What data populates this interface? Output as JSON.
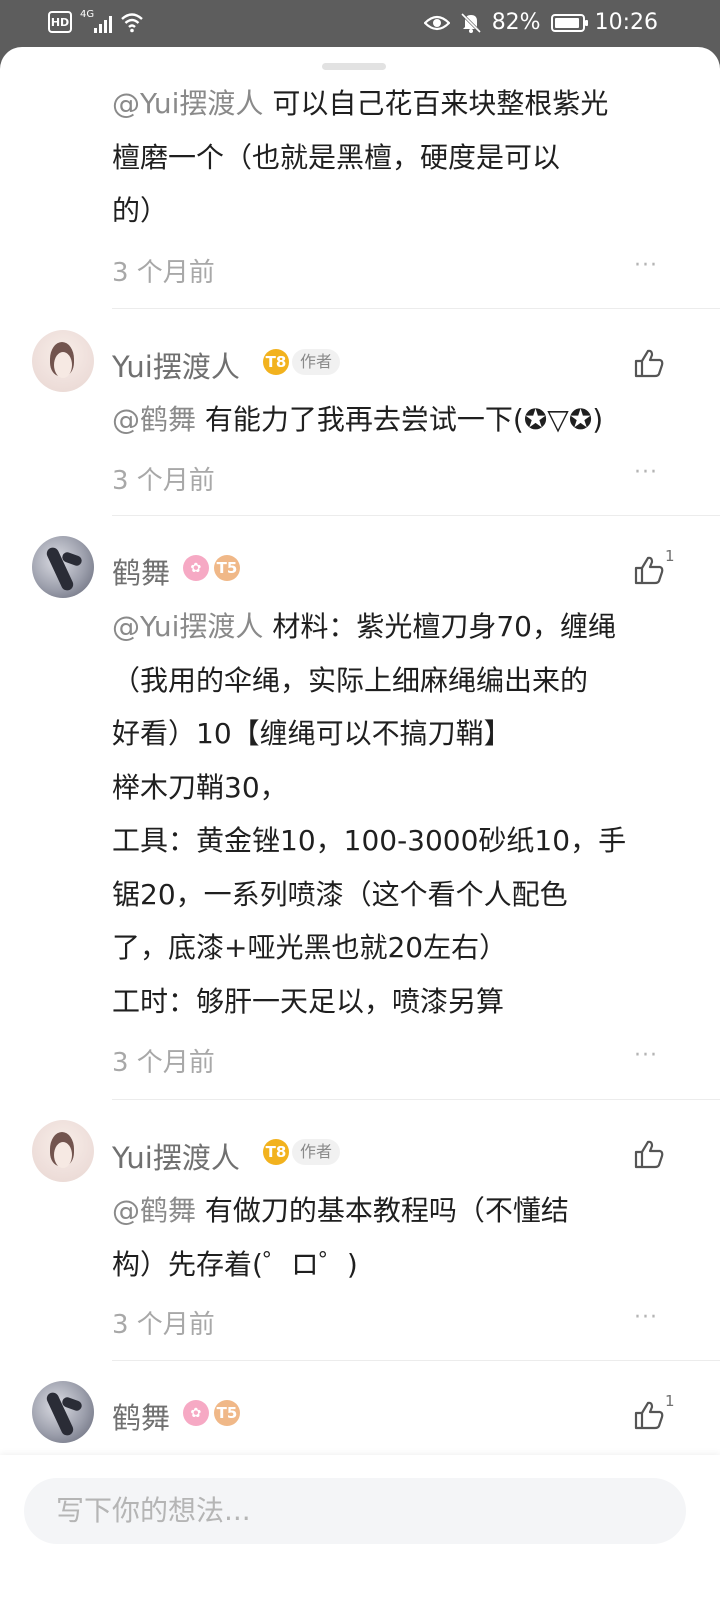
{
  "status_bar": {
    "hd": "HD",
    "network": "4G",
    "battery": "82%",
    "time": "10:26",
    "icons": [
      "hd-icon",
      "signal-icon",
      "wifi-icon",
      "eye-icon",
      "bell-off-icon",
      "battery-icon"
    ]
  },
  "comments": [
    {
      "lines": [
        "@Yui摆渡人 可以自己花百来块整根紫光",
        "檀磨一个（也就是黑檀，硬度是可以",
        "的）"
      ],
      "mention": "@Yui摆渡人",
      "time": "3 个月前",
      "more": "···"
    },
    {
      "name": "Yui摆渡人",
      "level": "T8",
      "tag": "作者",
      "mention": "@鹤舞",
      "lines": [
        "有能力了我再去尝试一下(✪▽✪)"
      ],
      "time": "3 个月前",
      "more": "···"
    },
    {
      "name": "鹤舞",
      "level": "T5",
      "badge": "✿",
      "likes": "1",
      "mention": "@Yui摆渡人",
      "lines": [
        "材料：紫光檀刀身70，缠绳",
        "（我用的伞绳，实际上细麻绳编出来的",
        "好看）10【缠绳可以不搞刀鞘】",
        "榉木刀鞘30，",
        "工具：黄金锉10，100-3000砂纸10，手",
        "锯20，一系列喷漆（这个看个人配色",
        "了，底漆+哑光黑也就20左右）",
        "工时：够肝一天足以，喷漆另算"
      ],
      "time": "3 个月前",
      "more": "···"
    },
    {
      "name": "Yui摆渡人",
      "level": "T8",
      "tag": "作者",
      "mention": "@鹤舞",
      "lines": [
        "有做刀的基本教程吗（不懂结",
        "构）先存着(゜ロ゜)"
      ],
      "time": "3 个月前",
      "more": "···"
    },
    {
      "name": "鹤舞",
      "level": "T5",
      "badge": "✿",
      "likes": "1"
    }
  ],
  "input": {
    "placeholder": "写下你的想法..."
  }
}
